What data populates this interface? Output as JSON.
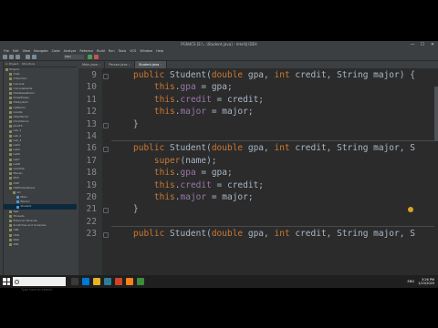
{
  "window": {
    "title": "PGN4CS [E:\\...\\Student.java] - IntelliJ IDEA",
    "controls": [
      "—",
      "☐",
      "✕"
    ]
  },
  "menu": [
    "File",
    "Edit",
    "View",
    "Navigate",
    "Code",
    "Analyze",
    "Refactor",
    "Build",
    "Run",
    "Tools",
    "VCS",
    "Window",
    "Help"
  ],
  "toolbar": {
    "run_config": "Main"
  },
  "project_panel": {
    "tabs": [
      "1: Project",
      "Structure"
    ],
    "items": [
      {
        "label": "Project",
        "level": 0,
        "selected": false
      },
      {
        "label": "Chat",
        "level": 1,
        "selected": false
      },
      {
        "label": "Collection",
        "level": 1,
        "selected": false
      },
      {
        "label": "Console",
        "level": 1,
        "selected": false
      },
      {
        "label": "ConsoleGame",
        "level": 1,
        "selected": false
      },
      {
        "label": "DatabaseDemo",
        "level": 1,
        "selected": false
      },
      {
        "label": "DrawShape",
        "level": 1,
        "selected": false
      },
      {
        "label": "FileSystem",
        "level": 1,
        "selected": false
      },
      {
        "label": "GitDemo",
        "level": 1,
        "selected": false
      },
      {
        "label": "Gradle",
        "level": 1,
        "selected": false
      },
      {
        "label": "HelloWorld",
        "level": 1,
        "selected": false
      },
      {
        "label": "Inheritance",
        "level": 1,
        "selected": false
      },
      {
        "label": "JavaFX",
        "level": 1,
        "selected": false
      },
      {
        "label": "Lab_1",
        "level": 1,
        "selected": false
      },
      {
        "label": "Lab_2",
        "level": 1,
        "selected": false
      },
      {
        "label": "Lab_3",
        "level": 1,
        "selected": false
      },
      {
        "label": "Lab4",
        "level": 1,
        "selected": false
      },
      {
        "label": "Lab5",
        "level": 1,
        "selected": false
      },
      {
        "label": "Lab6",
        "level": 1,
        "selected": false
      },
      {
        "label": "Lab7",
        "level": 1,
        "selected": false
      },
      {
        "label": "Lab8",
        "level": 1,
        "selected": false
      },
      {
        "label": "Lambda",
        "level": 1,
        "selected": false
      },
      {
        "label": "Maven",
        "level": 1,
        "selected": false
      },
      {
        "label": "MVC",
        "level": 1,
        "selected": false
      },
      {
        "label": "OOP",
        "level": 1,
        "selected": false
      },
      {
        "label": "OOPInheritance",
        "level": 1,
        "selected": false
      },
      {
        "label": "src",
        "level": 2,
        "selected": false
      },
      {
        "label": "Main",
        "level": 3,
        "selected": false
      },
      {
        "label": "Person",
        "level": 3,
        "selected": false
      },
      {
        "label": "Student",
        "level": 3,
        "selected": true
      },
      {
        "label": "Test",
        "level": 1,
        "selected": false
      },
      {
        "label": "Threads",
        "level": 1,
        "selected": false
      },
      {
        "label": "External Libraries",
        "level": 1,
        "selected": false
      },
      {
        "label": "Scratches and Consoles",
        "level": 1,
        "selected": false
      },
      {
        "label": "UML",
        "level": 1,
        "selected": false
      },
      {
        "label": "Utils",
        "level": 1,
        "selected": false
      },
      {
        "label": "Web",
        "level": 1,
        "selected": false
      },
      {
        "label": "XML",
        "level": 1,
        "selected": false
      }
    ]
  },
  "tabs": [
    {
      "label": "Main.java",
      "active": false
    },
    {
      "label": "Person.java",
      "active": false
    },
    {
      "label": "Student.java",
      "active": true
    }
  ],
  "editor": {
    "lines": [
      {
        "num": "9",
        "tokens": [
          [
            "kw",
            "public "
          ],
          [
            "type",
            "Student("
          ],
          [
            "ptype",
            "double"
          ],
          [
            "type",
            " gpa, "
          ],
          [
            "ptype",
            "int"
          ],
          [
            "type",
            " credit, String major) {"
          ]
        ]
      },
      {
        "num": "10",
        "tokens": [
          [
            "kw",
            "    this"
          ],
          [
            "type",
            "."
          ],
          [
            "fld",
            "gpa"
          ],
          [
            "type",
            " = gpa;"
          ]
        ]
      },
      {
        "num": "11",
        "tokens": [
          [
            "kw",
            "    this"
          ],
          [
            "type",
            "."
          ],
          [
            "fld",
            "credit"
          ],
          [
            "type",
            " = credit;"
          ]
        ]
      },
      {
        "num": "12",
        "tokens": [
          [
            "kw",
            "    this"
          ],
          [
            "type",
            "."
          ],
          [
            "fld",
            "major"
          ],
          [
            "type",
            " = major;"
          ]
        ]
      },
      {
        "num": "13",
        "tokens": [
          [
            "type",
            "}"
          ]
        ]
      },
      {
        "num": "14",
        "tokens": []
      },
      {
        "num": "16",
        "tokens": [
          [
            "kw",
            "public "
          ],
          [
            "type",
            "Student("
          ],
          [
            "ptype",
            "double"
          ],
          [
            "type",
            " gpa, "
          ],
          [
            "ptype",
            "int"
          ],
          [
            "type",
            " credit, String major, S"
          ]
        ]
      },
      {
        "num": "17",
        "tokens": [
          [
            "kw",
            "    super"
          ],
          [
            "type",
            "(name);"
          ]
        ]
      },
      {
        "num": "18",
        "tokens": [
          [
            "kw",
            "    this"
          ],
          [
            "type",
            "."
          ],
          [
            "fld",
            "gpa"
          ],
          [
            "type",
            " = gpa;"
          ]
        ]
      },
      {
        "num": "19",
        "tokens": [
          [
            "kw",
            "    this"
          ],
          [
            "type",
            "."
          ],
          [
            "fld",
            "credit"
          ],
          [
            "type",
            " = credit;"
          ]
        ]
      },
      {
        "num": "20",
        "tokens": [
          [
            "kw",
            "    this"
          ],
          [
            "type",
            "."
          ],
          [
            "fld",
            "major"
          ],
          [
            "type",
            " = major;"
          ]
        ]
      },
      {
        "num": "21",
        "tokens": [
          [
            "type",
            "}"
          ]
        ]
      },
      {
        "num": "22",
        "tokens": []
      },
      {
        "num": "23",
        "tokens": [
          [
            "kw",
            "public "
          ],
          [
            "type",
            "Student("
          ],
          [
            "ptype",
            "double"
          ],
          [
            "type",
            " gpa, "
          ],
          [
            "ptype",
            "int"
          ],
          [
            "type",
            " credit, String major, S"
          ]
        ]
      }
    ]
  },
  "bottom_tools": [
    "6: TODO",
    "Terminal",
    "Build",
    "Run"
  ],
  "status": [
    "10:1",
    "CRLF",
    "UTF-8",
    "4 spaces"
  ],
  "taskbar": {
    "search_placeholder": "Type here to search",
    "tray_items": [
      "ENG"
    ],
    "time": "3:26 PM",
    "date": "1/15/2020"
  }
}
